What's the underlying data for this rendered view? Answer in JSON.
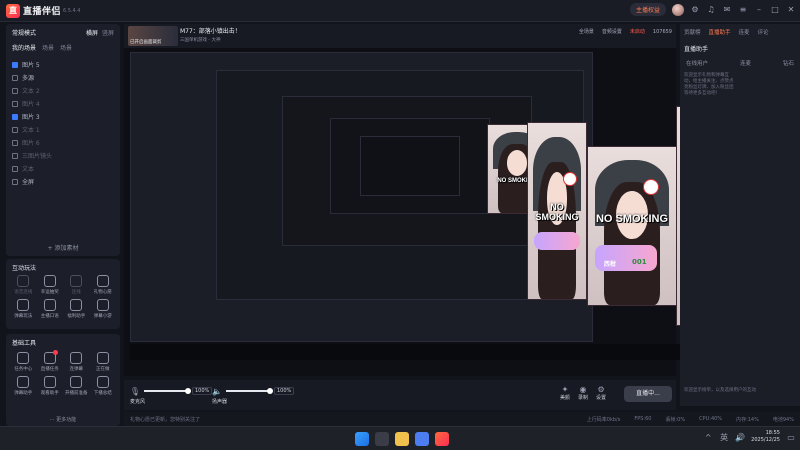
{
  "app": {
    "name": "直播伴侣",
    "version": "6.5.4.4"
  },
  "titlebar": {
    "live_status": "主播权益",
    "avatar_name": ""
  },
  "left_panel": {
    "mode": "常规模式",
    "actions": [
      "横屏",
      "竖屏"
    ],
    "tabs": [
      "我的场景",
      "场景",
      "场景"
    ],
    "scenes": [
      {
        "label": "图片 5",
        "checked": true,
        "dim": false
      },
      {
        "label": "多源",
        "checked": false,
        "dim": false
      },
      {
        "label": "文本 2",
        "checked": false,
        "dim": true
      },
      {
        "label": "图片 4",
        "checked": false,
        "dim": true
      },
      {
        "label": "图片 3",
        "checked": true,
        "dim": false
      },
      {
        "label": "文本 1",
        "checked": false,
        "dim": true
      },
      {
        "label": "图片 6",
        "checked": false,
        "dim": true
      },
      {
        "label": "三图片镜头",
        "checked": false,
        "dim": true
      },
      {
        "label": "文本",
        "checked": false,
        "dim": true
      },
      {
        "label": "全屏",
        "checked": false,
        "dim": false
      }
    ],
    "add_source": "+ 添加素材"
  },
  "interaction": {
    "title": "互动玩法",
    "tools": [
      {
        "label": "语音连线",
        "dim": true,
        "icon": "mic-icon"
      },
      {
        "label": "幸运抽奖",
        "dim": false,
        "icon": "gift-icon"
      },
      {
        "label": "连线",
        "dim": true,
        "icon": "link-icon"
      },
      {
        "label": "礼物心愿",
        "dim": false,
        "icon": "heart-icon"
      },
      {
        "label": "弹幕玩法",
        "dim": false,
        "icon": "play-icon"
      },
      {
        "label": "主播口语",
        "dim": false,
        "icon": "chat-icon"
      },
      {
        "label": "福利助手",
        "dim": false,
        "icon": "star-icon"
      },
      {
        "label": "弹幕小游",
        "dim": false,
        "icon": "game-icon"
      }
    ]
  },
  "basic_tools": {
    "title": "基础工具",
    "tools": [
      {
        "label": "任务中心",
        "badge": false,
        "icon": "task-icon"
      },
      {
        "label": "直播任务",
        "badge": true,
        "icon": "ad-icon"
      },
      {
        "label": "连弹幕",
        "badge": false,
        "icon": "danmu-icon"
      },
      {
        "label": "正在做",
        "badge": false,
        "icon": "download-icon"
      },
      {
        "label": "弹幕助手",
        "badge": false,
        "icon": "bubble-icon"
      },
      {
        "label": "观看助手",
        "badge": false,
        "icon": "eye-icon"
      },
      {
        "label": "开播前准备",
        "badge": false,
        "icon": "list-icon"
      },
      {
        "label": "下播总结",
        "badge": false,
        "icon": "file-icon"
      }
    ],
    "more": "··· 更多功能"
  },
  "stream_header": {
    "thumb_caption": "已开启画面裁剪",
    "title": "M77：部落小镇出击！",
    "subtitle": "三国单机游戏 - 大神",
    "camera_label": "全场景",
    "rec_label": "音频设置",
    "live_label": "未启动",
    "views_label": "107659"
  },
  "bottom": {
    "mic_label": "麦克风",
    "mic_pct": "100%",
    "mic_level": 1.0,
    "speaker_label": "扬声器",
    "speaker_pct": "100%",
    "speaker_level": 1.0,
    "btn_effect": "美颜",
    "btn_rec": "录制",
    "btn_settings": "设置",
    "golive": "直播中..."
  },
  "status": {
    "note": "礼物心愿已更新，您特别关注了",
    "bitrate": "上行码率0kb/s",
    "fps": "FPS:60",
    "dropped": "丢帧:0%",
    "cpu": "CPU:40%",
    "memory": "内存:14%",
    "battery": "电池94%"
  },
  "right_panel": {
    "tabs": [
      "贡献榜",
      "直播助手",
      "连麦",
      "评论"
    ],
    "helper": "直播助手",
    "subtabs": [
      "在线用户",
      "连麦",
      "钻石"
    ],
    "message": "欢迎显示礼物和弹幕互动，给主播关注、点赞点亮粉丝灯牌、加入粉丝团等待更多互动吧！",
    "footer_message": "欢迎显示榜单，以及选择用户的互动"
  },
  "overlay": {
    "no_smoking": "NO SMOKING",
    "sticker_text": "西柑",
    "count": "001"
  },
  "taskbar": {
    "ime": "英",
    "time": "18:55",
    "date": "2025/12/25"
  }
}
